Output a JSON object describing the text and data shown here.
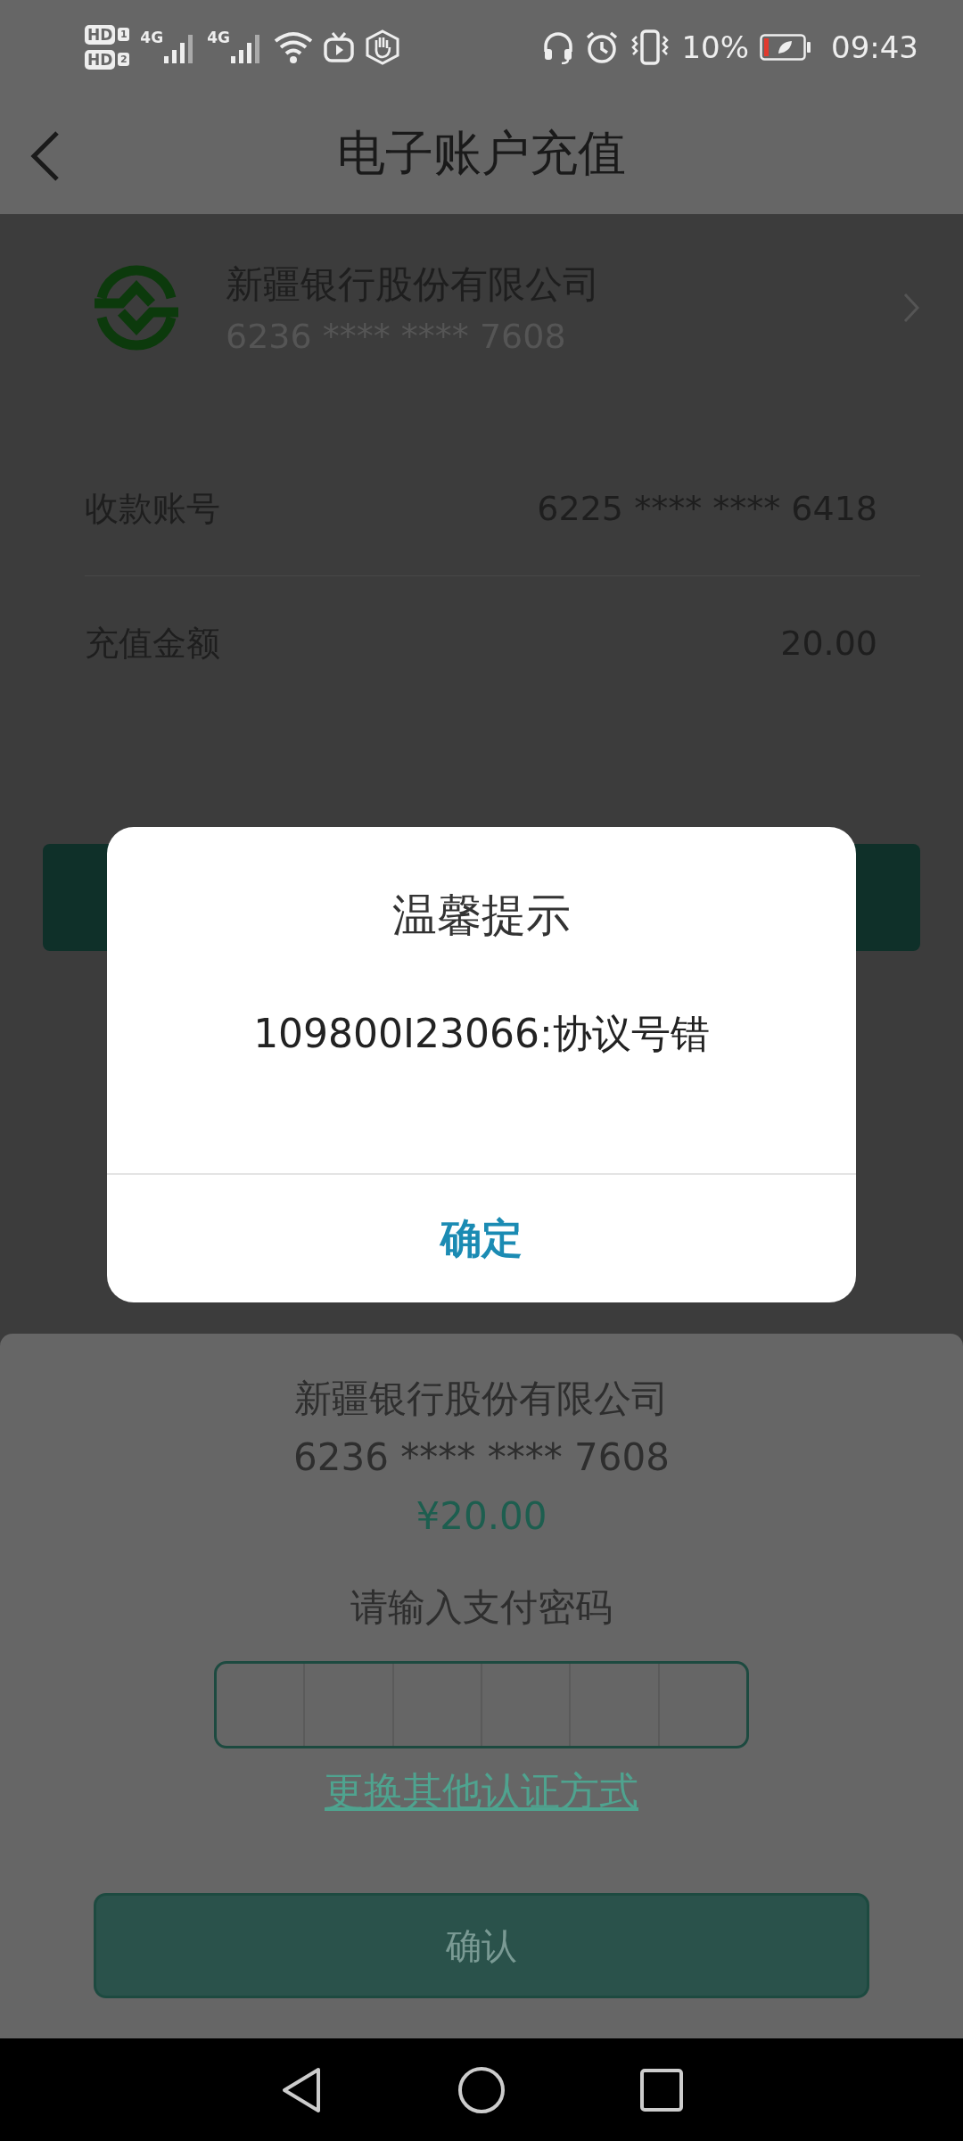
{
  "status_bar": {
    "hd_badges": [
      {
        "text": "HD",
        "slot": "1"
      },
      {
        "text": "HD",
        "slot": "2"
      }
    ],
    "network_types": [
      "4G",
      "4G"
    ],
    "battery": "10%",
    "time": "09:43"
  },
  "header": {
    "title": "电子账户充值"
  },
  "card": {
    "bank": "新疆银行股份有限公司",
    "number": "6236 **** **** 7608"
  },
  "fields": [
    {
      "label": "收款账号",
      "value": "6225 **** **** 6418"
    },
    {
      "label": "充值金额",
      "value": "20.00"
    }
  ],
  "dialog": {
    "title": "温馨提示",
    "message": "109800I23066:协议号错",
    "button": "确定"
  },
  "pay_sheet": {
    "bank": "新疆银行股份有限公司",
    "number": "6236 **** **** 7608",
    "amount": "¥20.00",
    "prompt": "请输入支付密码",
    "link": "更换其他认证方式",
    "button": "确认"
  }
}
